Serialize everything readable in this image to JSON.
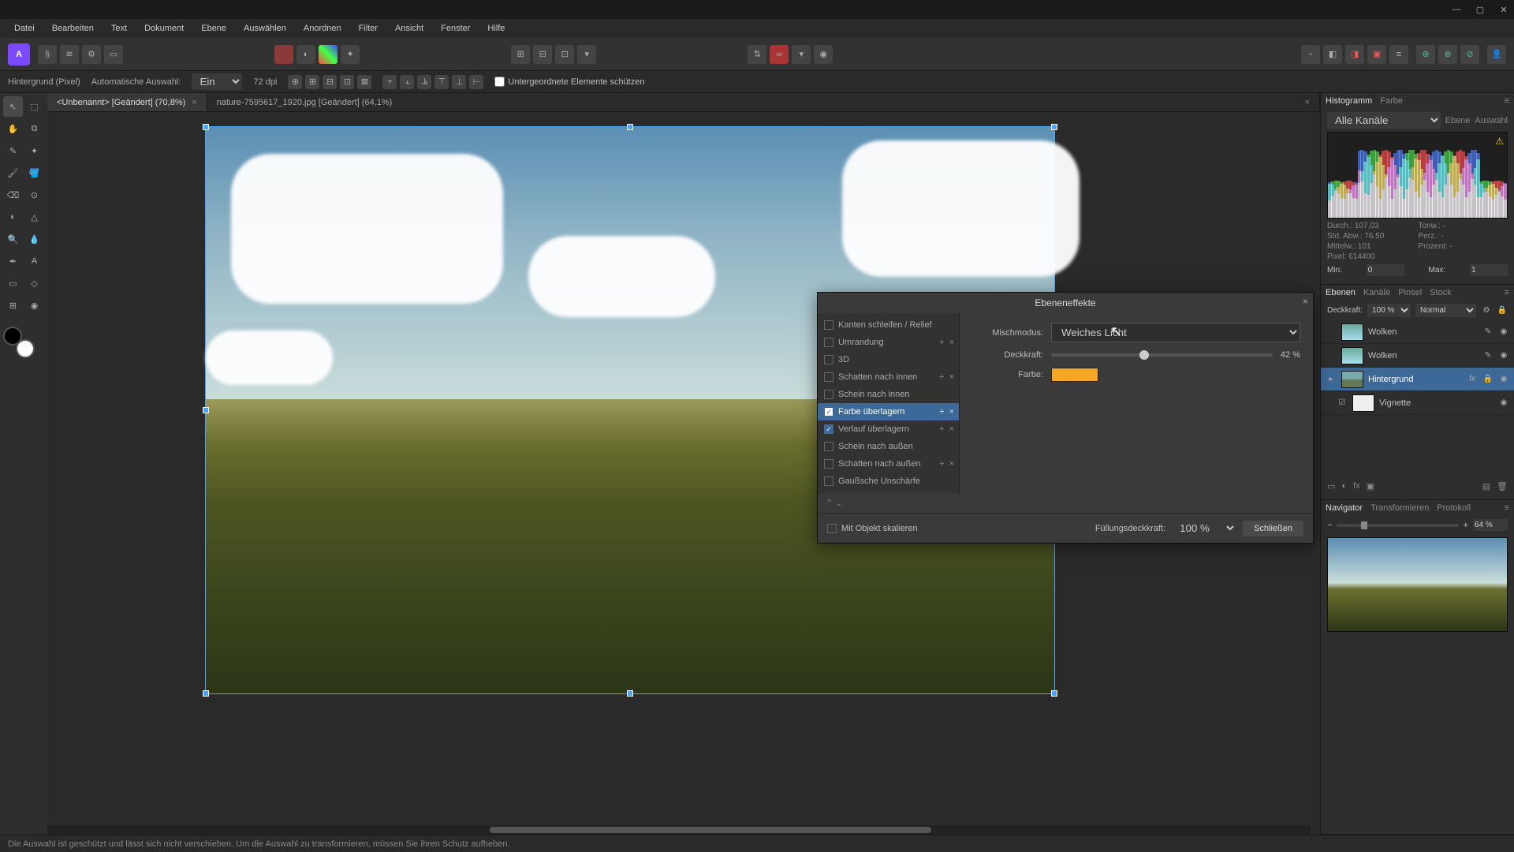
{
  "window": {
    "minimize": "—",
    "maximize": "▢",
    "close": "✕"
  },
  "menu": [
    "Datei",
    "Bearbeiten",
    "Text",
    "Dokument",
    "Ebene",
    "Auswählen",
    "Anordnen",
    "Filter",
    "Ansicht",
    "Fenster",
    "Hilfe"
  ],
  "context": {
    "layer_info": "Hintergrund (Pixel)",
    "mode_label": "Automatische Auswahl:",
    "mode_value": "Ein",
    "dpi": "72 dpi",
    "protect": "Untergeordnete Elemente schützen"
  },
  "tabs": [
    {
      "label": "<Unbenannt> [Geändert] (70,8%)",
      "active": true
    },
    {
      "label": "nature-7595617_1920.jpg [Geändert] (64,1%)",
      "active": false
    }
  ],
  "histogram": {
    "tabs": [
      "Histogramm",
      "Farbe"
    ],
    "channel": "Alle Kanäle",
    "btn_layer": "Ebene",
    "btn_sel": "Auswahl",
    "stats": {
      "durch": "Durch.: 107,03",
      "stdabw": "Std. Abw.: 76.50",
      "mittelw": "Mittelw.: 101",
      "pixel": "Pixel: 614400",
      "tonw": "Tonw.: -",
      "perc": "Perz.: -",
      "prozent": "Prozent: -"
    },
    "min_l": "Min:",
    "min_v": "0",
    "max_l": "Max:",
    "max_v": "1"
  },
  "layers_panel": {
    "tabs": [
      "Ebenen",
      "Kanäle",
      "Pinsel",
      "Stock"
    ],
    "opacity_l": "Deckkraft:",
    "opacity_v": "100 %",
    "blend": "Normal",
    "items": [
      {
        "name": "Wolken",
        "thumb": "sky"
      },
      {
        "name": "Wolken",
        "thumb": "sky"
      },
      {
        "name": "Hintergrund",
        "thumb": "field",
        "selected": true,
        "fx": "fx"
      },
      {
        "name": "Vignette",
        "thumb": "white",
        "indent": true
      }
    ]
  },
  "navigator": {
    "tabs": [
      "Navigator",
      "Transformieren",
      "Protokoll"
    ],
    "zoom": "64 %"
  },
  "dialog": {
    "title": "Ebeneneffekte",
    "effects": [
      {
        "label": "Kanten schleifen / Relief",
        "on": false
      },
      {
        "label": "Umrandung",
        "on": false,
        "acts": true
      },
      {
        "label": "3D",
        "on": false
      },
      {
        "label": "Schatten nach innen",
        "on": false,
        "acts": true
      },
      {
        "label": "Schein nach innen",
        "on": false
      },
      {
        "label": "Farbe überlagern",
        "on": true,
        "selected": true,
        "acts": true
      },
      {
        "label": "Verlauf überlagern",
        "on": true,
        "acts": true
      },
      {
        "label": "Schein nach außen",
        "on": false
      },
      {
        "label": "Schatten nach außen",
        "on": false,
        "acts": true
      },
      {
        "label": "Gaußsche Unschärfe",
        "on": false
      }
    ],
    "props": {
      "blend_l": "Mischmodus:",
      "blend_v": "Weiches Licht",
      "opacity_l": "Deckkraft:",
      "opacity_v": "42 %",
      "color_l": "Farbe:",
      "color_hex": "#f5a623"
    },
    "scale_l": "Mit Objekt skalieren",
    "fill_l": "Füllungsdeckkraft:",
    "fill_v": "100 %",
    "close_btn": "Schließen",
    "arrows": "⌃ ⌄"
  },
  "status": "Die Auswahl ist geschützt und lässt sich nicht verschieben. Um die Auswahl zu transformieren, müssen Sie ihren Schutz aufheben."
}
